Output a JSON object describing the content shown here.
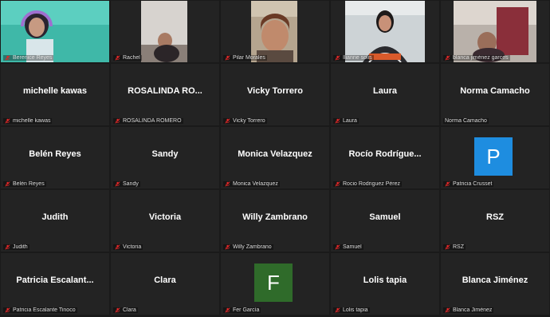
{
  "colors": {
    "tile_bg": "#232323",
    "mute_red": "#e02828",
    "avatar_blue": "#1e8de0",
    "avatar_green": "#2f6b2a"
  },
  "participants": [
    {
      "label": "Berenice Reyes"
    },
    {
      "label": "Rachel"
    },
    {
      "label": "Pilar Morales"
    },
    {
      "label": "Ilianne solis"
    },
    {
      "label": "blanca jiménez garces"
    },
    {
      "name": "michelle kawas",
      "label": "michelle kawas"
    },
    {
      "name": "ROSALINDA RO...",
      "label": "ROSALINDA ROMERO"
    },
    {
      "name": "Vicky Torrero",
      "label": "Vicky Torrero"
    },
    {
      "name": "Laura",
      "label": "Laura"
    },
    {
      "name": "Norma Camacho",
      "label": "Norma Camacho"
    },
    {
      "name": "Belén Reyes",
      "label": "Belén Reyes"
    },
    {
      "name": "Sandy",
      "label": "Sandy"
    },
    {
      "name": "Monica Velazquez",
      "label": "Monica Velazquez"
    },
    {
      "name": "Rocío Rodrígue...",
      "label": "Rocio Rodriguez Pérez"
    },
    {
      "avatar": "P",
      "label": "Patricia Crusset"
    },
    {
      "name": "Judith",
      "label": "Judith"
    },
    {
      "name": "Victoria",
      "label": "Victoria"
    },
    {
      "name": "Willy Zambrano",
      "label": "Willy Zambrano"
    },
    {
      "name": "Samuel",
      "label": "Samuel"
    },
    {
      "name": "RSZ",
      "label": "RSZ"
    },
    {
      "name": "Patricia Escalant...",
      "label": "Patricia Escalante Tinoco"
    },
    {
      "name": "Clara",
      "label": "Clara"
    },
    {
      "avatar": "F",
      "label": "Fer García"
    },
    {
      "name": "Lolis tapia",
      "label": "Lolis tapia"
    },
    {
      "name": "Blanca Jiménez",
      "label": "Blanca Jiménez"
    }
  ]
}
